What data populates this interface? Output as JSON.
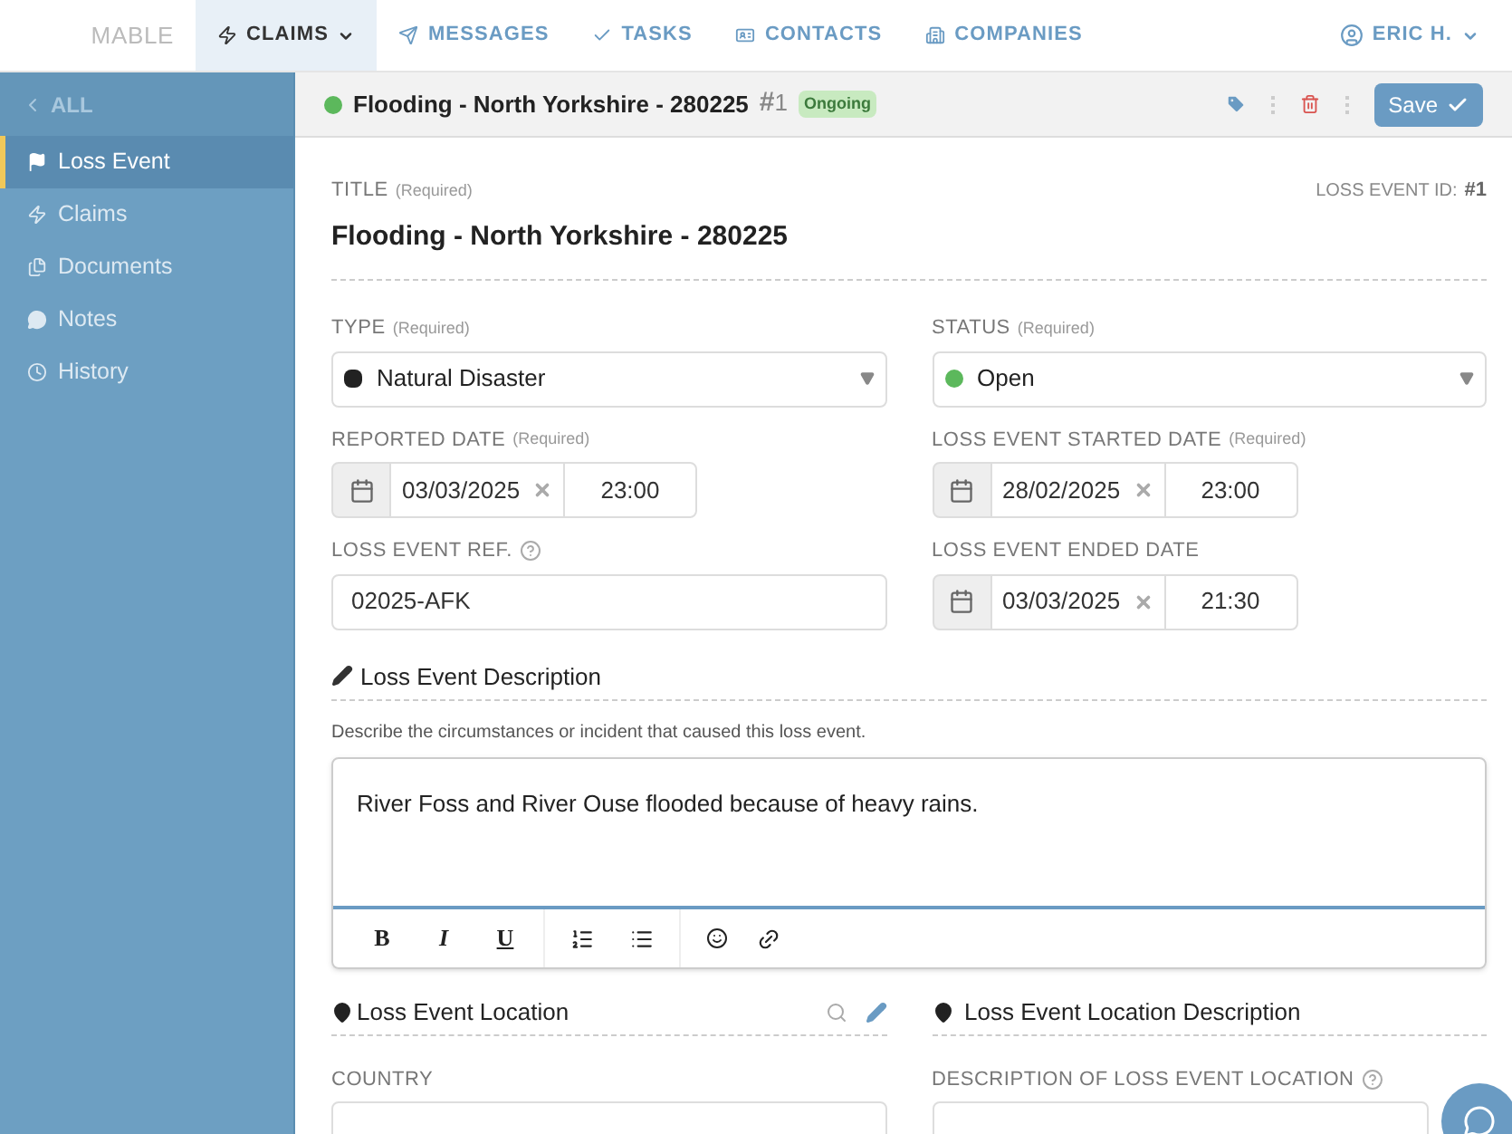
{
  "navbar": {
    "brand": "MABLE",
    "items": [
      {
        "label": "CLAIMS",
        "selected": true,
        "dropdown": true
      },
      {
        "label": "MESSAGES",
        "selected": false,
        "dropdown": false
      },
      {
        "label": "TASKS",
        "selected": false,
        "dropdown": false
      },
      {
        "label": "CONTACTS",
        "selected": false,
        "dropdown": false
      },
      {
        "label": "COMPANIES",
        "selected": false,
        "dropdown": false
      }
    ],
    "user": "ERIC H."
  },
  "sidebar": {
    "back": "ALL",
    "items": [
      {
        "label": "Loss Event",
        "selected": true
      },
      {
        "label": "Claims",
        "selected": false
      },
      {
        "label": "Documents",
        "selected": false
      },
      {
        "label": "Notes",
        "selected": false
      },
      {
        "label": "History",
        "selected": false
      }
    ]
  },
  "header": {
    "title": "Flooding - North Yorkshire - 280225",
    "hash": "#",
    "number": "1",
    "badge": "Ongoing",
    "save": "Save"
  },
  "form": {
    "title_label": "TITLE",
    "title_req": "(Required)",
    "title": "Flooding - North Yorkshire - 280225",
    "id_label": "LOSS EVENT ID:",
    "id_value": "#1",
    "type": {
      "label": "TYPE",
      "req": "(Required)",
      "value": "Natural Disaster",
      "color": "#222222"
    },
    "status": {
      "label": "STATUS",
      "req": "(Required)",
      "value": "Open",
      "color": "#5cb85c"
    },
    "dates": [
      {
        "label": "REPORTED DATE",
        "req": "(Required)",
        "date": "03/03/2025",
        "time": "23:00"
      },
      {
        "label": "LOSS EVENT STARTED DATE",
        "req": "(Required)",
        "date": "28/02/2025",
        "time": "23:00"
      }
    ],
    "ref": {
      "label": "LOSS EVENT REF.",
      "value": "02025-AFK"
    },
    "ended": {
      "label": "LOSS EVENT ENDED DATE",
      "date": "03/03/2025",
      "time": "21:30"
    },
    "description": {
      "heading": "Loss Event Description",
      "hint": "Describe the circumstances or incident that caused this loss event.",
      "value": "River Foss and River Ouse flooded because of heavy rains.",
      "toolbar": [
        "B",
        "I",
        "U"
      ]
    },
    "location": {
      "heading": "Loss Event Location",
      "country_label": "COUNTRY"
    },
    "location_desc": {
      "heading": "Loss Event Location Description",
      "label": "DESCRIPTION OF LOSS EVENT LOCATION"
    }
  }
}
